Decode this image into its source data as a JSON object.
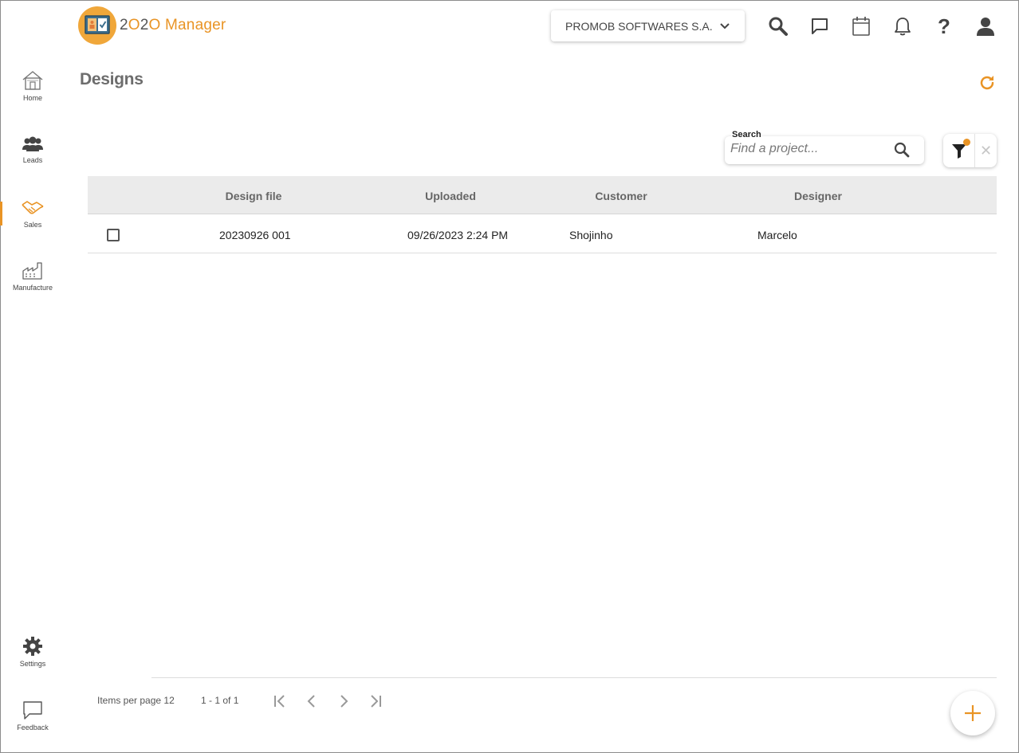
{
  "app": {
    "name_prefix": "2",
    "name_o1": "O",
    "name_mid": "2",
    "name_o2": "O",
    "name_suffix": "Manager"
  },
  "header": {
    "company": "PROMOB SOFTWARES S.A.",
    "icons": [
      "search-icon",
      "chat-icon",
      "calendar-icon",
      "bell-icon",
      "help-icon",
      "user-icon"
    ],
    "help_glyph": "?"
  },
  "sidebar": {
    "items": [
      {
        "label": "Home",
        "icon": "home-icon"
      },
      {
        "label": "Leads",
        "icon": "people-icon"
      },
      {
        "label": "Sales",
        "icon": "handshake-icon",
        "active": true
      },
      {
        "label": "Manufacture",
        "icon": "factory-icon"
      }
    ],
    "bottom": [
      {
        "label": "Settings",
        "icon": "gear-icon"
      },
      {
        "label": "Feedback",
        "icon": "feedback-icon"
      }
    ],
    "accent": "#e99425"
  },
  "page": {
    "title": "Designs"
  },
  "search": {
    "label": "Search",
    "placeholder": "Find a project...",
    "value": ""
  },
  "filter": {
    "clear_glyph": "✕"
  },
  "table": {
    "columns": [
      "Design file",
      "Uploaded",
      "Customer",
      "Designer"
    ],
    "rows": [
      {
        "design_file": "20230926 001",
        "uploaded": "09/26/2023 2:24 PM",
        "customer": "Shojinho",
        "designer": "Marcelo",
        "checked": false
      }
    ]
  },
  "pagination": {
    "items_per_page_label": "Items per page",
    "items_per_page": "12",
    "range": "1 - 1 of 1"
  }
}
